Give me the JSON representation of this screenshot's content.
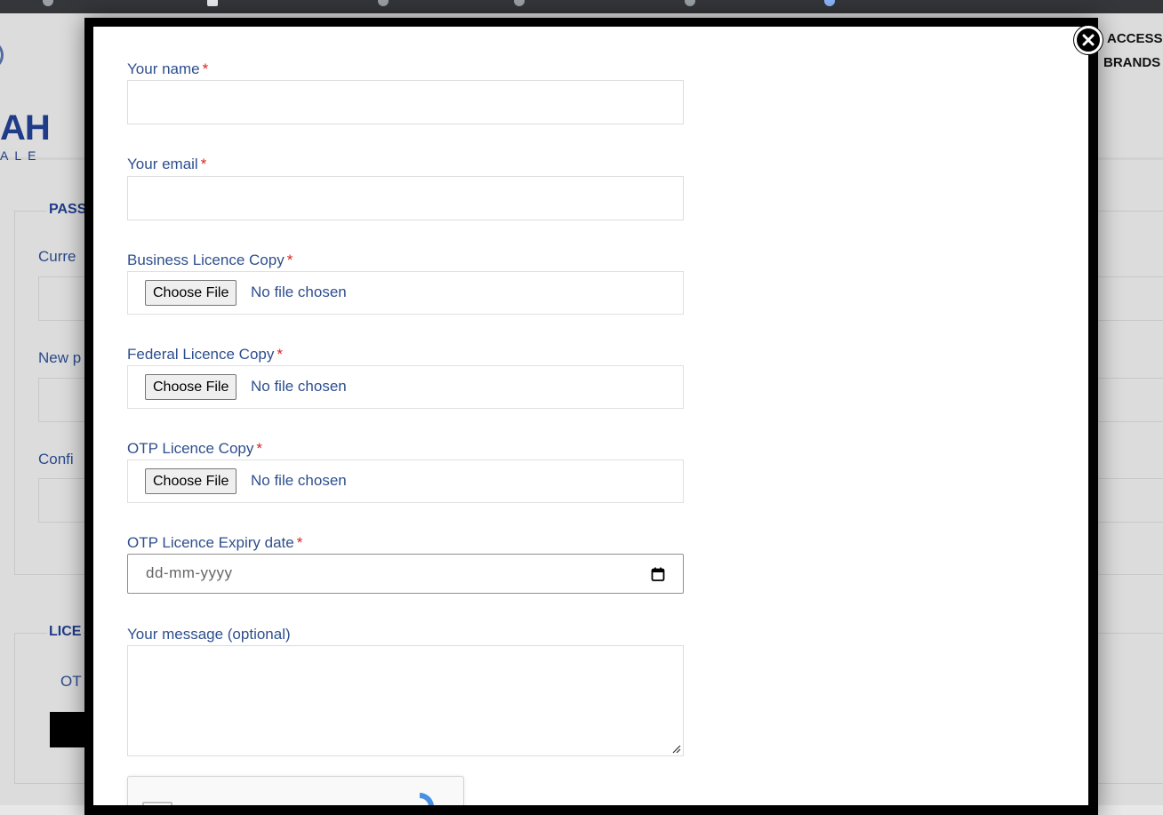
{
  "background": {
    "logo_text": "AH",
    "logo_sub": "ALE",
    "nav": [
      "ACCESS",
      "BRANDS"
    ],
    "password_legend": "PASS",
    "fields": [
      "Curre",
      "New p",
      "Confi"
    ],
    "licence_legend": "LICE",
    "licence_text": "OT"
  },
  "modal": {
    "close_icon": "close-icon",
    "name": {
      "label": "Your name",
      "required": "*"
    },
    "email": {
      "label": "Your email",
      "required": "*"
    },
    "business": {
      "label": "Business Licence Copy",
      "required": "*",
      "button": "Choose File",
      "status": "No file chosen"
    },
    "federal": {
      "label": "Federal Licence Copy",
      "required": "*",
      "button": "Choose File",
      "status": "No file chosen"
    },
    "otp": {
      "label": "OTP Licence Copy",
      "required": "*",
      "button": "Choose File",
      "status": "No file chosen"
    },
    "expiry": {
      "label": "OTP Licence Expiry date",
      "required": "*",
      "placeholder": "dd-mm-yyyy",
      "icon": "calendar-icon"
    },
    "message": {
      "label": "Your message (optional)"
    },
    "recaptcha_icon": "recaptcha-icon"
  }
}
